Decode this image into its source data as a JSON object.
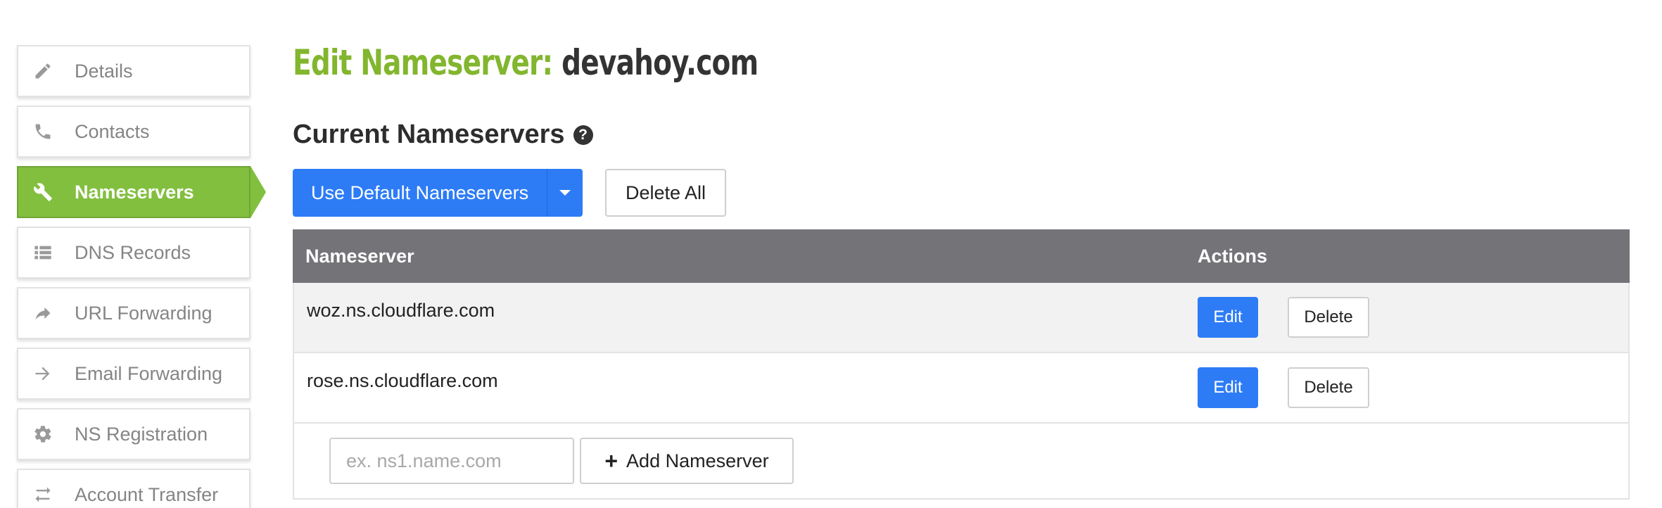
{
  "sidebar": {
    "items": [
      {
        "label": "Details",
        "icon": "pencil-icon"
      },
      {
        "label": "Contacts",
        "icon": "phone-icon"
      },
      {
        "label": "Nameservers",
        "icon": "wrench-icon",
        "active": true
      },
      {
        "label": "DNS Records",
        "icon": "list-icon"
      },
      {
        "label": "URL Forwarding",
        "icon": "share-arrow-icon"
      },
      {
        "label": "Email Forwarding",
        "icon": "arrow-right-icon"
      },
      {
        "label": "NS Registration",
        "icon": "gear-icon"
      },
      {
        "label": "Account Transfer",
        "icon": "swap-icon"
      }
    ]
  },
  "page": {
    "title_prefix": "Edit Nameserver:",
    "domain": "devahoy.com",
    "section_title": "Current Nameservers",
    "help_glyph": "?"
  },
  "toolbar": {
    "use_default_label": "Use Default Nameservers",
    "delete_all_label": "Delete All"
  },
  "table": {
    "headers": {
      "nameserver": "Nameserver",
      "actions": "Actions"
    },
    "rows": [
      {
        "nameserver": "woz.ns.cloudflare.com",
        "edit_label": "Edit",
        "delete_label": "Delete"
      },
      {
        "nameserver": "rose.ns.cloudflare.com",
        "edit_label": "Edit",
        "delete_label": "Delete"
      }
    ]
  },
  "add_form": {
    "placeholder": "ex. ns1.name.com",
    "value": "",
    "add_label": "Add Nameserver",
    "plus_glyph": "+"
  },
  "colors": {
    "accent_green": "#82bf3f",
    "primary_blue": "#2d7cf6",
    "table_header": "#747378"
  }
}
